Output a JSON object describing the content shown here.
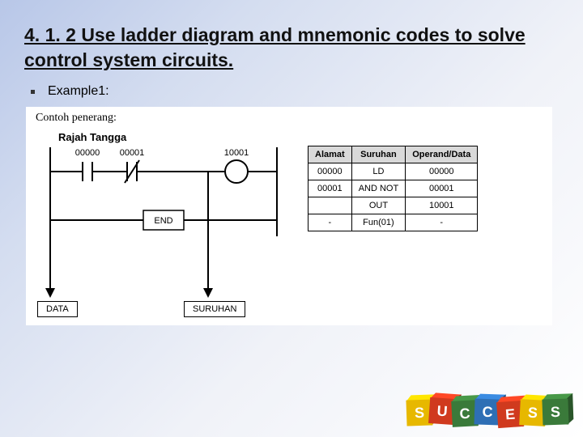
{
  "title": "4. 1. 2 Use ladder diagram and mnemonic codes to solve control system circuits.",
  "example_label": "Example1:",
  "panel": {
    "contoh": "Contoh penerang:",
    "rajah": "Rajah Tangga",
    "rung_labels": {
      "in1": "00000",
      "in2": "00001",
      "out": "10001"
    },
    "end": "END",
    "data_box": "DATA",
    "suruhan_box": "SURUHAN"
  },
  "mnemonic": {
    "headers": [
      "Alamat",
      "Suruhan",
      "Operand/Data"
    ],
    "rows": [
      [
        "00000",
        "LD",
        "00000"
      ],
      [
        "00001",
        "AND NOT",
        "00001"
      ],
      [
        "",
        "OUT",
        "10001"
      ],
      [
        "-",
        "Fun(01)",
        "-"
      ]
    ]
  },
  "blocks": [
    "S",
    "U",
    "C",
    "C",
    "E",
    "S",
    "S"
  ]
}
